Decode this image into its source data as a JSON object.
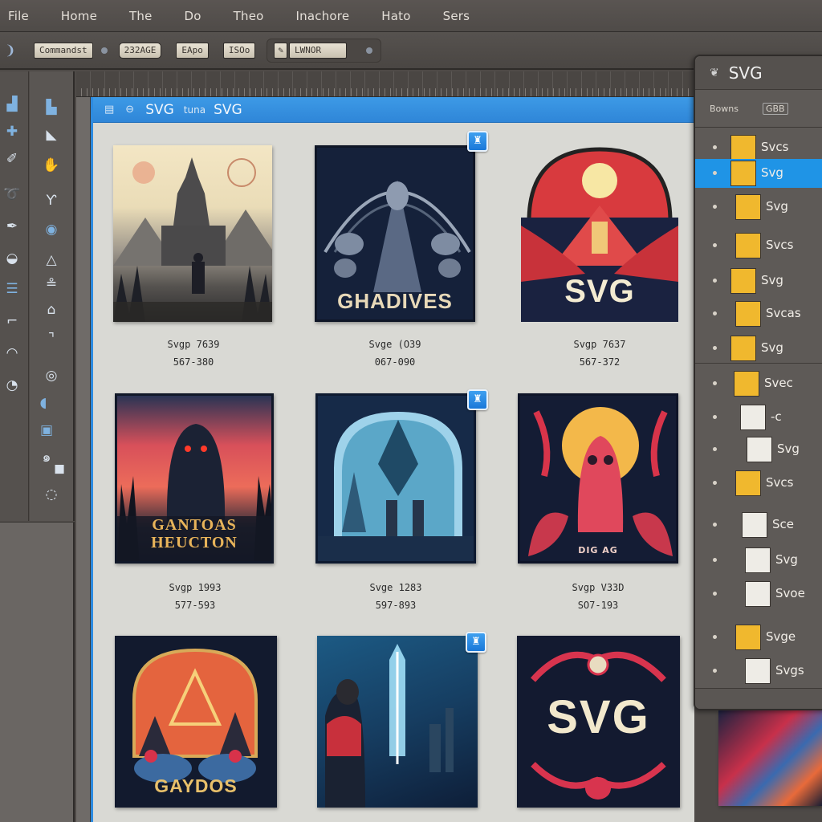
{
  "menubar": {
    "items": [
      "File",
      "Home",
      "The",
      "Do",
      "Theo",
      "Inachore",
      "Hato",
      "Sers"
    ]
  },
  "toolbar": {
    "fields": [
      "Commandst",
      "232AGE",
      "EApo",
      "ISOo",
      "LWNOR"
    ],
    "arrow_icon": "chevron-right-icon"
  },
  "document": {
    "header": {
      "icons": [
        "layout-icon",
        "link-icon"
      ],
      "title": "SVG",
      "subtitle": "tuna",
      "title2": "SVG"
    },
    "accent_color": "#2f86d8",
    "cards": [
      {
        "title": "",
        "caption_line1": "Svgp 7639",
        "caption_line2": "567-380",
        "pinned": false,
        "theme": "castle"
      },
      {
        "title": "GHADIVES",
        "caption_line1": "Svge (O39",
        "caption_line2": "067-090",
        "pinned": true,
        "theme": "ornate-navy"
      },
      {
        "title": "SVG",
        "caption_line1": "Svgp 7637",
        "caption_line2": "567-372",
        "pinned": false,
        "theme": "red-arch"
      },
      {
        "title": "GANTOAS HEUCTON",
        "caption_line1": "Svgp 1993",
        "caption_line2": "577-593",
        "pinned": false,
        "theme": "hooded-figure"
      },
      {
        "title": "",
        "caption_line1": "Svge 1283",
        "caption_line2": "597-893",
        "pinned": true,
        "theme": "blue-diamond"
      },
      {
        "title": "DIG AG",
        "caption_line1": "Svgp V33D",
        "caption_line2": "SO7-193",
        "pinned": false,
        "theme": "red-octopus"
      },
      {
        "title": "GAYDOS",
        "caption_line1": "",
        "caption_line2": "",
        "pinned": false,
        "theme": "triangle-arch"
      },
      {
        "title": "",
        "caption_line1": "",
        "caption_line2": "",
        "pinned": true,
        "theme": "glowing-sword"
      },
      {
        "title": "SVG",
        "caption_line1": "",
        "caption_line2": "",
        "pinned": false,
        "theme": "red-ornament"
      }
    ]
  },
  "layers_panel": {
    "title": "SVG",
    "title_icon": "layers-icon",
    "options": [
      "Bowns",
      "GBB"
    ],
    "layers": [
      {
        "label": "Svcs",
        "color": "#f0b82e",
        "selected": false
      },
      {
        "label": "Svg",
        "color": "#f0b82e",
        "selected": true
      },
      {
        "label": "Svg",
        "color": "#f0b82e",
        "selected": false
      },
      {
        "label": "Svcs",
        "color": "#f0b82e",
        "selected": false
      },
      {
        "label": "Svg",
        "color": "#f0b82e",
        "selected": false
      },
      {
        "label": "Svcas",
        "color": "#f0b82e",
        "selected": false
      },
      {
        "label": "Svg",
        "color": "#f0b82e",
        "selected": false
      },
      {
        "label": "Svec",
        "color": "#f0b82e",
        "selected": false
      },
      {
        "label": "-c",
        "color": "#eeece6",
        "selected": false
      },
      {
        "label": "Svg",
        "color": "#eeece6",
        "selected": false
      },
      {
        "label": "Svcs",
        "color": "#f0b82e",
        "selected": false
      },
      {
        "label": "Sce",
        "color": "#eeece6",
        "selected": false
      },
      {
        "label": "Svg",
        "color": "#eeece6",
        "selected": false
      },
      {
        "label": "Svoe",
        "color": "#eeece6",
        "selected": false
      },
      {
        "label": "Svge",
        "color": "#f0b82e",
        "selected": false
      },
      {
        "label": "Svgs",
        "color": "#eeece6",
        "selected": false
      }
    ],
    "selection_color": "#1f94e6"
  }
}
